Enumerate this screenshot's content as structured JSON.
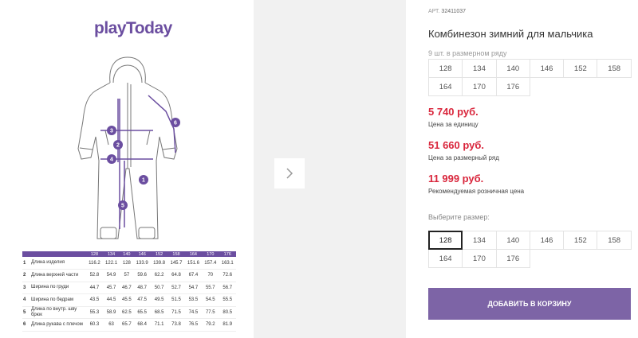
{
  "brand": {
    "logo_text": "playToday"
  },
  "product": {
    "article_label": "АРТ.",
    "article_number": "32411037",
    "title": "Комбинезон зимний для мальчика",
    "pack_note": "9 шт. в размерном ряду"
  },
  "pack_sizes": [
    "128",
    "134",
    "140",
    "146",
    "152",
    "158",
    "164",
    "170",
    "176"
  ],
  "prices": [
    {
      "value": "5 740 руб.",
      "note": "Цена за единицу"
    },
    {
      "value": "51 660 руб.",
      "note": "Цена за размерный ряд"
    },
    {
      "value": "11 999 руб.",
      "note": "Рекомендуемая розничная цена"
    }
  ],
  "size_select": {
    "label": "Выберите размер:",
    "options": [
      "128",
      "134",
      "140",
      "146",
      "152",
      "158",
      "164",
      "170",
      "176"
    ],
    "selected": "128"
  },
  "cart": {
    "button_label": "ДОБАВИТЬ В КОРЗИНУ"
  },
  "gallery": {
    "next_icon": "chevron-right-icon"
  },
  "size_chart": {
    "markers": [
      "1",
      "2",
      "3",
      "4",
      "5",
      "6"
    ],
    "header": [
      "128",
      "134",
      "140",
      "146",
      "152",
      "158",
      "164",
      "170",
      "176"
    ],
    "rows": [
      {
        "num": "1",
        "label": "Длина изделия",
        "values": [
          "116.2",
          "122.1",
          "128",
          "133.9",
          "139.8",
          "145.7",
          "151.6",
          "157.4",
          "163.1"
        ]
      },
      {
        "num": "2",
        "label": "Длина верхней части",
        "values": [
          "52.8",
          "54.9",
          "57",
          "59.6",
          "62.2",
          "64.8",
          "67.4",
          "70",
          "72.6"
        ]
      },
      {
        "num": "3",
        "label": "Ширина по груди",
        "values": [
          "44.7",
          "45.7",
          "46.7",
          "48.7",
          "50.7",
          "52.7",
          "54.7",
          "55.7",
          "56.7"
        ]
      },
      {
        "num": "4",
        "label": "Ширина по бедрам",
        "values": [
          "43.5",
          "44.5",
          "45.5",
          "47.5",
          "49.5",
          "51.5",
          "53.5",
          "54.5",
          "55.5"
        ]
      },
      {
        "num": "5",
        "label": "Длина по внутр. шву брюк",
        "values": [
          "55.3",
          "58.9",
          "62.5",
          "65.5",
          "68.5",
          "71.5",
          "74.5",
          "77.5",
          "80.5"
        ]
      },
      {
        "num": "6",
        "label": "Длина рукава с плечом",
        "values": [
          "60.3",
          "63",
          "65.7",
          "68.4",
          "71.1",
          "73.8",
          "76.5",
          "79.2",
          "81.9"
        ]
      }
    ]
  },
  "colors": {
    "accent": "#7d64a6",
    "price": "#d9263c",
    "brand": "#6b4ea0"
  }
}
